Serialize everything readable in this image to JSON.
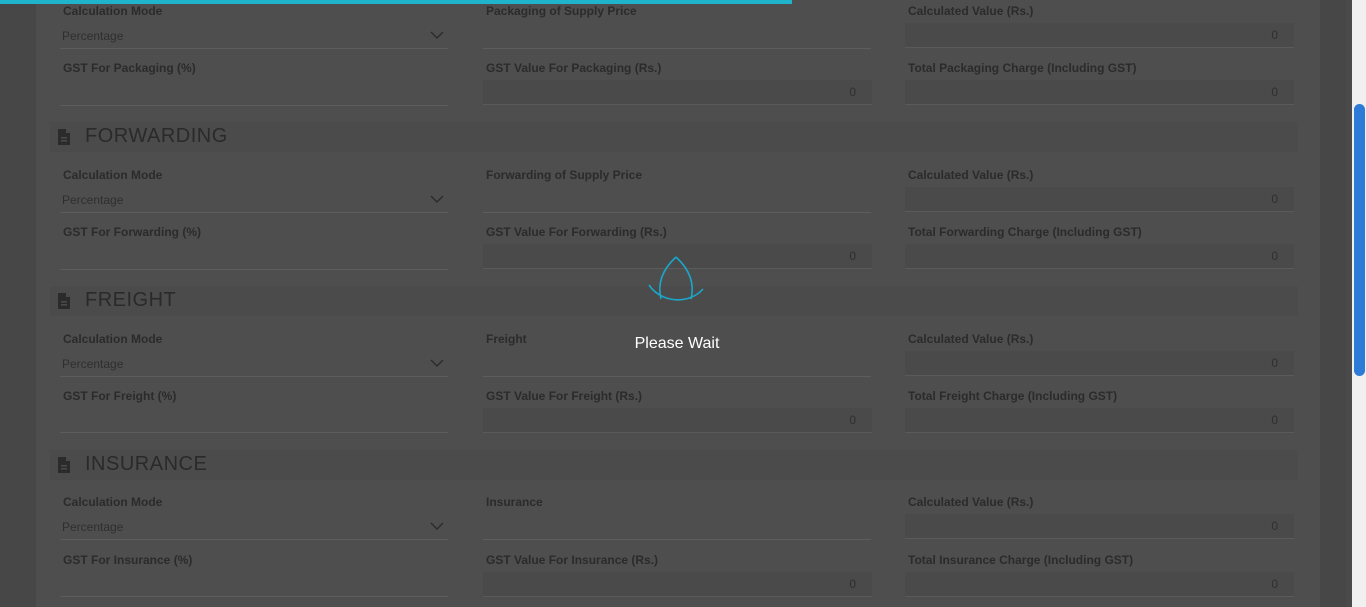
{
  "loading": {
    "message": "Please Wait",
    "progress": 0.58
  },
  "top_block": {
    "calc_mode_label": "Calculation Mode",
    "calc_mode_value": "Percentage",
    "supply_price_label": "Packaging of Supply Price",
    "calc_value_label": "Calculated Value (Rs.)",
    "calc_value": "0",
    "gst_label": "GST For Packaging (%)",
    "gst_value_label": "GST Value For Packaging (Rs.)",
    "gst_value": "0",
    "total_label": "Total Packaging Charge (Including GST)",
    "total_value": "0"
  },
  "forwarding": {
    "title": "FORWARDING",
    "calc_mode_label": "Calculation Mode",
    "calc_mode_value": "Percentage",
    "supply_price_label": "Forwarding of Supply Price",
    "calc_value_label": "Calculated Value (Rs.)",
    "calc_value": "0",
    "gst_label": "GST For Forwarding (%)",
    "gst_value_label": "GST Value For Forwarding (Rs.)",
    "gst_value": "0",
    "total_label": "Total Forwarding Charge (Including GST)",
    "total_value": "0"
  },
  "freight": {
    "title": "FREIGHT",
    "calc_mode_label": "Calculation Mode",
    "calc_mode_value": "Percentage",
    "supply_price_label": "Freight",
    "calc_value_label": "Calculated Value (Rs.)",
    "calc_value": "0",
    "gst_label": "GST For Freight (%)",
    "gst_value_label": "GST Value For Freight (Rs.)",
    "gst_value": "0",
    "total_label": "Total Freight Charge (Including GST)",
    "total_value": "0"
  },
  "insurance": {
    "title": "INSURANCE",
    "calc_mode_label": "Calculation Mode",
    "calc_mode_value": "Percentage",
    "supply_price_label": "Insurance",
    "calc_value_label": "Calculated Value (Rs.)",
    "calc_value": "0",
    "gst_label": "GST For Insurance (%)",
    "gst_value_label": "GST Value For Insurance (Rs.)",
    "gst_value": "0",
    "total_label": "Total Insurance Charge (Including GST)",
    "total_value": "0"
  },
  "icons": {
    "section": "document-icon",
    "dropdown": "chevron-down-icon",
    "loader": "spinner-icon"
  },
  "colors": {
    "accent": "#1fb3cc",
    "scrollbar": "#2d7bd6",
    "overlay": "#4a4a4a"
  }
}
